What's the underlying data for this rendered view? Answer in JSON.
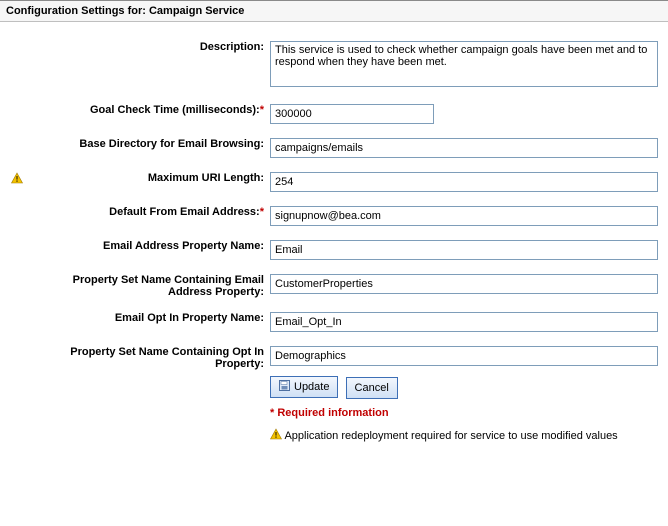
{
  "header": {
    "prefix": "Configuration Settings for: ",
    "name": "Campaign Service"
  },
  "fields": {
    "description": {
      "label": "Description:",
      "value": "This service is used to check whether campaign goals have been met and to respond when they have been met."
    },
    "goalCheck": {
      "label": "Goal Check Time (milliseconds):",
      "required": true,
      "value": "300000"
    },
    "baseDir": {
      "label": "Base Directory for Email Browsing:",
      "value": "campaigns/emails"
    },
    "maxUri": {
      "label": "Maximum URI Length:",
      "value": "254",
      "warn": true
    },
    "defaultFrom": {
      "label": "Default From Email Address:",
      "required": true,
      "value": "signupnow@bea.com"
    },
    "emailProp": {
      "label": "Email Address Property Name:",
      "value": "Email"
    },
    "psEmail": {
      "label": "Property Set Name Containing Email Address Property:",
      "value": "CustomerProperties"
    },
    "optInProp": {
      "label": "Email Opt In Property Name:",
      "value": "Email_Opt_In"
    },
    "psOptIn": {
      "label": "Property Set Name Containing Opt In Property:",
      "value": "Demographics"
    }
  },
  "buttons": {
    "update": "Update",
    "cancel": "Cancel"
  },
  "notes": {
    "required": "* Required information",
    "redeploy": "Application redeployment required for service to use modified values"
  },
  "asterisk": "*"
}
